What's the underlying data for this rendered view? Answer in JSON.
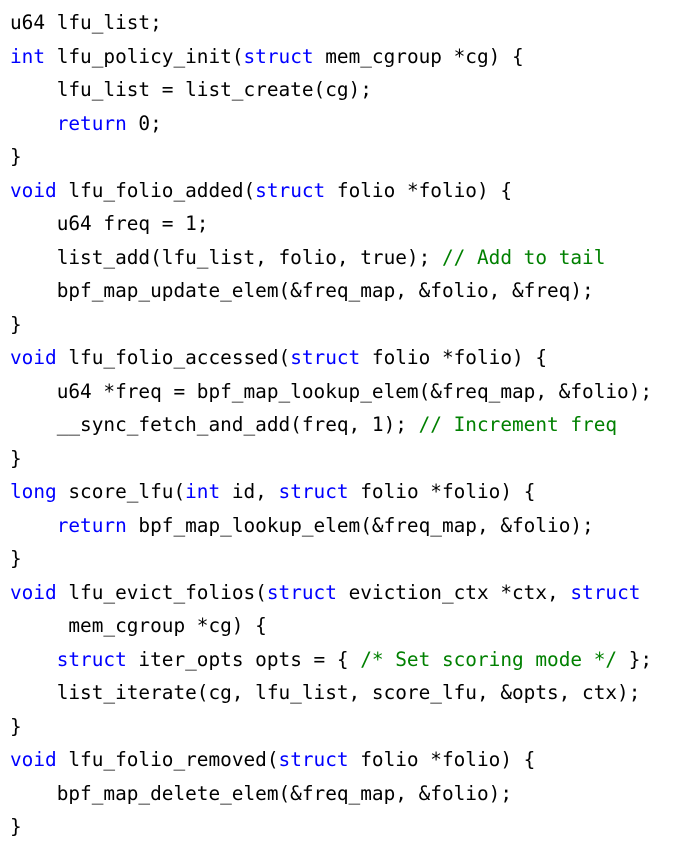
{
  "colors": {
    "text": "#000000",
    "keyword": "#0000ff",
    "comment": "#008000",
    "background": "#ffffff"
  },
  "code": {
    "lines": [
      [
        {
          "t": "u64 lfu_list;"
        }
      ],
      [
        {
          "t": "int",
          "k": "kw"
        },
        {
          "t": " lfu_policy_init("
        },
        {
          "t": "struct",
          "k": "kw"
        },
        {
          "t": " mem_cgroup *cg) {"
        }
      ],
      [
        {
          "t": "    lfu_list = list_create(cg);"
        }
      ],
      [
        {
          "t": "    "
        },
        {
          "t": "return",
          "k": "kw"
        },
        {
          "t": " 0;"
        }
      ],
      [
        {
          "t": "}"
        }
      ],
      [
        {
          "t": "void",
          "k": "kw"
        },
        {
          "t": " lfu_folio_added("
        },
        {
          "t": "struct",
          "k": "kw"
        },
        {
          "t": " folio *folio) {"
        }
      ],
      [
        {
          "t": "    u64 freq = 1;"
        }
      ],
      [
        {
          "t": "    list_add(lfu_list, folio, true); "
        },
        {
          "t": "// Add to tail",
          "k": "cm"
        }
      ],
      [
        {
          "t": "    bpf_map_update_elem(&freq_map, &folio, &freq);"
        }
      ],
      [
        {
          "t": "}"
        }
      ],
      [
        {
          "t": "void",
          "k": "kw"
        },
        {
          "t": " lfu_folio_accessed("
        },
        {
          "t": "struct",
          "k": "kw"
        },
        {
          "t": " folio *folio) {"
        }
      ],
      [
        {
          "t": "    u64 *freq = bpf_map_lookup_elem(&freq_map, &folio);"
        }
      ],
      [
        {
          "t": "    __sync_fetch_and_add(freq, 1); "
        },
        {
          "t": "// Increment freq",
          "k": "cm"
        }
      ],
      [
        {
          "t": "}"
        }
      ],
      [
        {
          "t": "long",
          "k": "kw"
        },
        {
          "t": " score_lfu("
        },
        {
          "t": "int",
          "k": "kw"
        },
        {
          "t": " id, "
        },
        {
          "t": "struct",
          "k": "kw"
        },
        {
          "t": " folio *folio) {"
        }
      ],
      [
        {
          "t": "    "
        },
        {
          "t": "return",
          "k": "kw"
        },
        {
          "t": " bpf_map_lookup_elem(&freq_map, &folio);"
        }
      ],
      [
        {
          "t": "}"
        }
      ],
      [
        {
          "t": "void",
          "k": "kw"
        },
        {
          "t": " lfu_evict_folios("
        },
        {
          "t": "struct",
          "k": "kw"
        },
        {
          "t": " eviction_ctx *ctx, "
        },
        {
          "t": "struct",
          "k": "kw"
        }
      ],
      [
        {
          "t": "     mem_cgroup *cg) {"
        }
      ],
      [
        {
          "t": "    "
        },
        {
          "t": "struct",
          "k": "kw"
        },
        {
          "t": " iter_opts opts = { "
        },
        {
          "t": "/* Set scoring mode */",
          "k": "cm"
        },
        {
          "t": " };"
        }
      ],
      [
        {
          "t": "    list_iterate(cg, lfu_list, score_lfu, &opts, ctx);"
        }
      ],
      [
        {
          "t": "}"
        }
      ],
      [
        {
          "t": "void",
          "k": "kw"
        },
        {
          "t": " lfu_folio_removed("
        },
        {
          "t": "struct",
          "k": "kw"
        },
        {
          "t": " folio *folio) {"
        }
      ],
      [
        {
          "t": "    bpf_map_delete_elem(&freq_map, &folio);"
        }
      ],
      [
        {
          "t": "}"
        }
      ]
    ]
  }
}
